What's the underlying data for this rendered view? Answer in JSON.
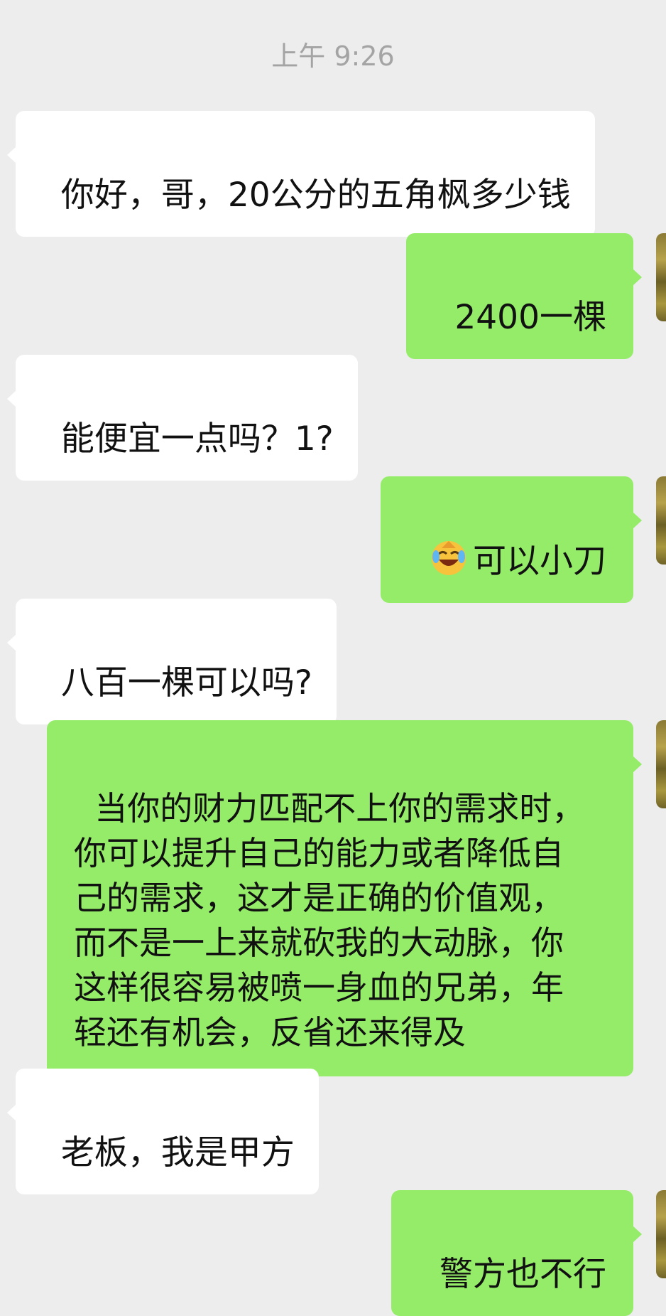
{
  "timestamp": "上午 9:26",
  "messages": [
    {
      "side": "in",
      "text": "你好，哥，20公分的五角枫多少钱"
    },
    {
      "side": "out",
      "text": "2400一棵"
    },
    {
      "side": "in",
      "text": "能便宜一点吗？1?"
    },
    {
      "side": "out",
      "emoji": "face-with-tears-of-joy-icon",
      "text": "可以小刀"
    },
    {
      "side": "in",
      "text": "八百一棵可以吗?"
    },
    {
      "side": "out",
      "text": "当你的财力匹配不上你的需求时，\n你可以提升自己的能力或者降低自\n己的需求，这才是正确的价值观，\n而不是一上来就砍我的大动脉，你\n这样很容易被喷一身血的兄弟，年\n轻还有机会，反省还来得及"
    },
    {
      "side": "in",
      "text": "老板，我是甲方"
    },
    {
      "side": "out",
      "text": "警方也不行"
    }
  ],
  "colors": {
    "background": "#ededed",
    "incoming_bubble": "#ffffff",
    "outgoing_bubble": "#95ec69",
    "timestamp": "#a4a4a4"
  }
}
